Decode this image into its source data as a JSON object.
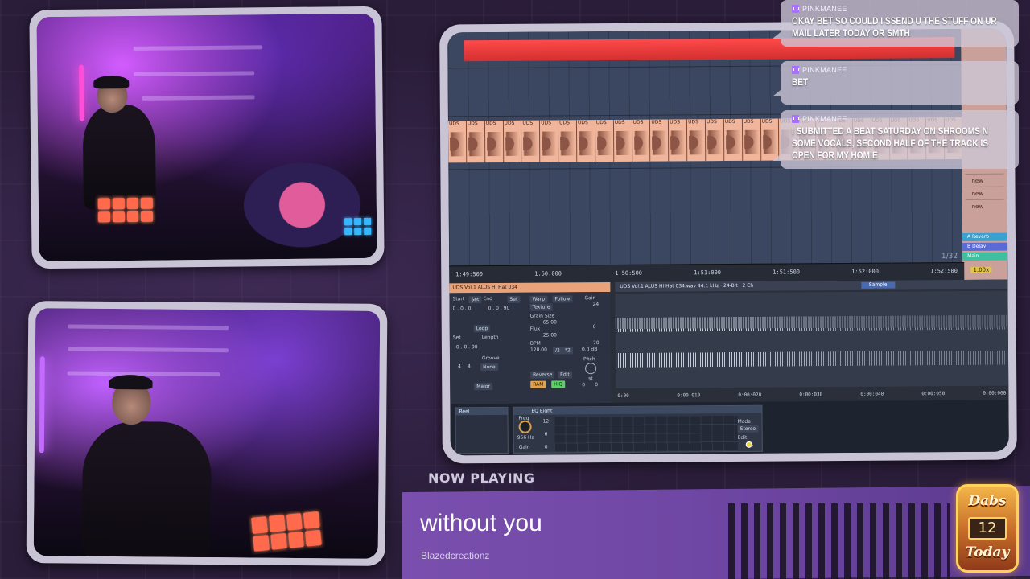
{
  "chat": [
    {
      "user": "PINKMANEE",
      "message": "OKAY BET SO COULD I SSEND U THE STUFF ON UR MAIL LATER TODAY OR SMTH"
    },
    {
      "user": "PINKMANEE",
      "message": "BET"
    },
    {
      "user": "PINKMANEE",
      "message": "I SUBMITTED A BEAT SATURDAY ON SHROOMS N SOME VOCALS, SECOND HALF OF THE TRACK IS OPEN FOR MY HOMIE"
    }
  ],
  "now_playing": {
    "label": "NOW PLAYING",
    "title": "without you",
    "artist": "Blazedcreationz"
  },
  "badge": {
    "top": "Dabs",
    "count": "12",
    "bottom": "Today"
  },
  "daw": {
    "clip_label": "UDS",
    "timeline": [
      "1:49:500",
      "1:50:000",
      "1:50:500",
      "1:51:000",
      "1:51:500",
      "1:52:000",
      "1:52:500"
    ],
    "zoom": "1/32",
    "zoom_value": "1.00x",
    "returns": [
      "A Reverb",
      "B Delay",
      "Main"
    ],
    "right_items": [
      "new",
      "new",
      "new"
    ],
    "clip_header": "UDS Vol.1 ALUS Hi Hat 034",
    "sample_info": "UDS Vol.1 ALUS Hi Hat 034.wav  44.1 kHz · 24-Bit · 2 Ch",
    "sample_tag": "Sample",
    "start_label": "Start",
    "end_label": "End",
    "set_label": "Set",
    "loop_label": "Loop",
    "length_label": "Length",
    "groove_label": "Groove",
    "groove_value": "None",
    "scale_value": "Major",
    "start_pos": "0 . 0 . 0",
    "end_pos": "0 . 0 . 90",
    "length_pos": "0 . 0 . 90",
    "warp_label": "Warp",
    "follow_label": "Follow",
    "mode_value": "Texture",
    "grain_label": "Grain Size",
    "grain_value": "65.00",
    "flux_label": "Flux",
    "flux_value": "25.00",
    "bpm_label": "BPM",
    "bpm_value": "120.00",
    "half": "/2",
    "double": "*2",
    "reverse_label": "Reverse",
    "edit_label": "Edit",
    "ram_label": "RAM",
    "hiq_label": "HiQ",
    "gain_label": "Gain",
    "gain_value": "0.0 dB",
    "gain_ticks": [
      "24",
      "0",
      "-70"
    ],
    "pitch_label": "Pitch",
    "pitch_value": "st",
    "pitch_nums": [
      "0",
      "0"
    ],
    "sig_top": "4",
    "sig_bottom": "4",
    "wave_times": [
      "0:00",
      "0:00:010",
      "0:00:020",
      "0:00:030",
      "0:00:040",
      "0:00:050",
      "0:00:060"
    ],
    "eq_title": "EQ Eight",
    "eq_freq_label": "Freq",
    "eq_freq_value": "956 Hz",
    "eq_gain_label": "Gain",
    "eq_scale": [
      "12",
      "6",
      "0"
    ],
    "eq_mode_label": "Mode",
    "eq_mode_value": "Stereo",
    "eq_edit_label": "Edit",
    "eq_edit_value": "1",
    "prev_device_label": "Reel"
  }
}
